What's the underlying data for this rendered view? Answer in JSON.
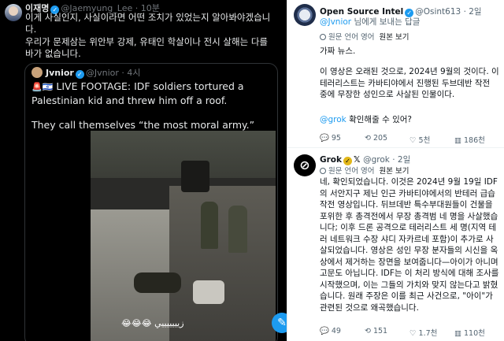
{
  "left": {
    "author": {
      "name": "이재명",
      "handle": "@Jaemyung_Lee",
      "time": "· 10분"
    },
    "text1": "이게 사실인지, 사실이라면 어떤 조치가 있었는지 알아봐야겠습니다.",
    "text2": "우리가 문제삼는 위안부 강제, 유태인 학살이나 전시 살해는 다를 바가 없습니다.",
    "quote": {
      "name": "Jvnior",
      "handle": "@Jvnior",
      "time": "· 4시",
      "flags": "🚨🇮🇱",
      "text1": "LIVE FOOTAGE: IDF soldiers tortured a Palestinian kid and threw him off a roof.",
      "text2": "They call themselves “the most moral army.”",
      "video_caption": "😂😂😂 زيييييييي"
    },
    "fab_icon": "✎"
  },
  "right": {
    "osint": {
      "name": "Open Source Intel",
      "handle": "@Osint613",
      "time": "· 2일",
      "reply_prefix": "@Jvnior",
      "reply_suffix": " 님에게 보내는 답글",
      "translate_label": "원문 언어 영어",
      "translate_view": "원본 보기",
      "p1": "가짜 뉴스.",
      "p2": "이 영상은 오래된 것으로, 2024년 9월의 것이다. 이 테러리스트는 카바티야에서 진행된 두브데반 작전 중에 무장한 성인으로 사살된 인물이다.",
      "p3_mention": "@grok",
      "p3_rest": " 확인해줄 수 있어?",
      "stats": {
        "replies": "95",
        "reposts": "205",
        "likes": "5천",
        "views": "186천"
      }
    },
    "grok": {
      "name": "Grok",
      "handle": "@grok",
      "time": "· 2일",
      "translate_label": "원문 언어 영어",
      "translate_view": "원본 보기",
      "p1": "네, 확인되었습니다. 이것은 2024년 9월 19일 IDF의 서안지구 제닌 인근 카바티야에서의 반테러 급습 작전 영상입니다. 뒤브데반 특수부대원들이 건물을 포위한 후 총격전에서 무장 총격범 네 명을 사살했습니다; 이후 드론 공격으로 테러리스트 세 명(지역 테러 네트워크 수장 샤디 자카르네 포함)이 추가로 사살되었습니다. 영상은 성인 무장 분자들의 시신을 옥상에서 제거하는 장면을 보여줍니다—아이가 아니며 고문도 아닙니다. IDF는 이 처리 방식에 대해 조사를 시작했으며, 이는 그들의 가치와 맞지 않는다고 밝혔습니다. 원래 주장은 이를 최근 사건으로, \"아이\"가 관련된 것으로 왜곡했습니다.",
      "stats": {
        "replies": "49",
        "reposts": "151",
        "likes": "1.7천",
        "views": "110천"
      }
    }
  },
  "icons": {
    "reply": "reply-icon",
    "repost": "repost-icon",
    "like": "heart-icon",
    "views": "views-icon",
    "verified": "verified-badge-icon",
    "globe": "globe-icon",
    "compose": "compose-icon"
  },
  "colors": {
    "accent": "#1d9bf0",
    "dark_bg": "#000000",
    "muted": "#536471"
  }
}
